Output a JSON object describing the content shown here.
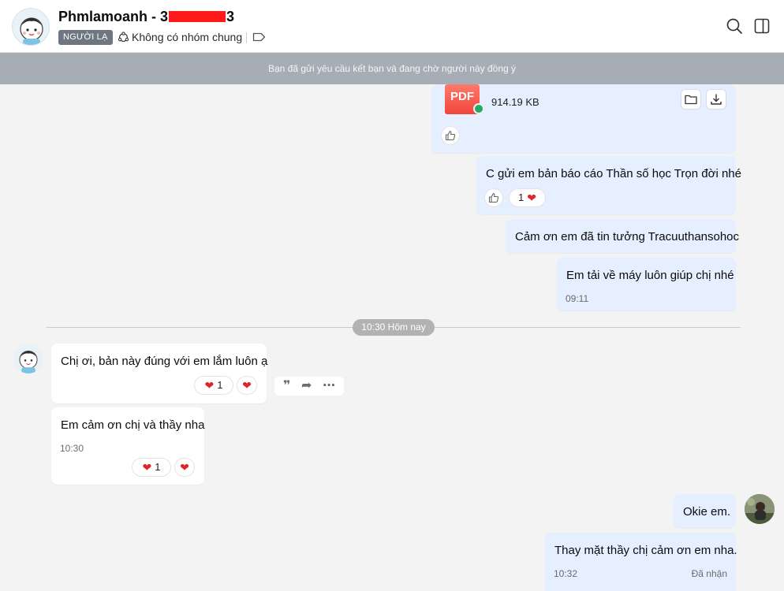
{
  "header": {
    "name_prefix": "Phmlamoanh - 3",
    "name_suffix": "3",
    "tag": "NGƯỜI LẠ",
    "common_groups": "Không có nhóm chung"
  },
  "banner": {
    "text": "Bạn đã gửi yêu cầu kết bạn và đang chờ người này đồng ý"
  },
  "messages": {
    "file": {
      "type_label": "PDF",
      "size": "914.19 KB"
    },
    "m1": {
      "text": "C gửi em bản báo cáo Thần số học Trọn đời nhé",
      "heart_count": "1"
    },
    "m2": {
      "text": "Cảm ơn em đã tin tưởng Tracuuthansohoc"
    },
    "m3": {
      "text": "Em tải về máy luôn giúp chị nhé",
      "time": "09:11"
    },
    "divider": "10:30 Hôm nay",
    "t1": {
      "text": "Chị ơi, bản này đúng với em lắm luôn ạ",
      "heart_count": "1"
    },
    "t2": {
      "text": "Em cảm ơn chị và thầy nha",
      "time": "10:30",
      "heart_count": "1"
    },
    "m4": {
      "text": "Okie em."
    },
    "m5": {
      "text": "Thay mặt thầy chị cảm ơn em nha.",
      "time": "10:32",
      "status": "Đã nhận"
    }
  },
  "colors": {
    "my_bubble": "#e5efff",
    "their_bubble": "#ffffff",
    "banner": "#a6adb5",
    "heart": "#e0242c",
    "redaction": "#ff1a1a"
  }
}
